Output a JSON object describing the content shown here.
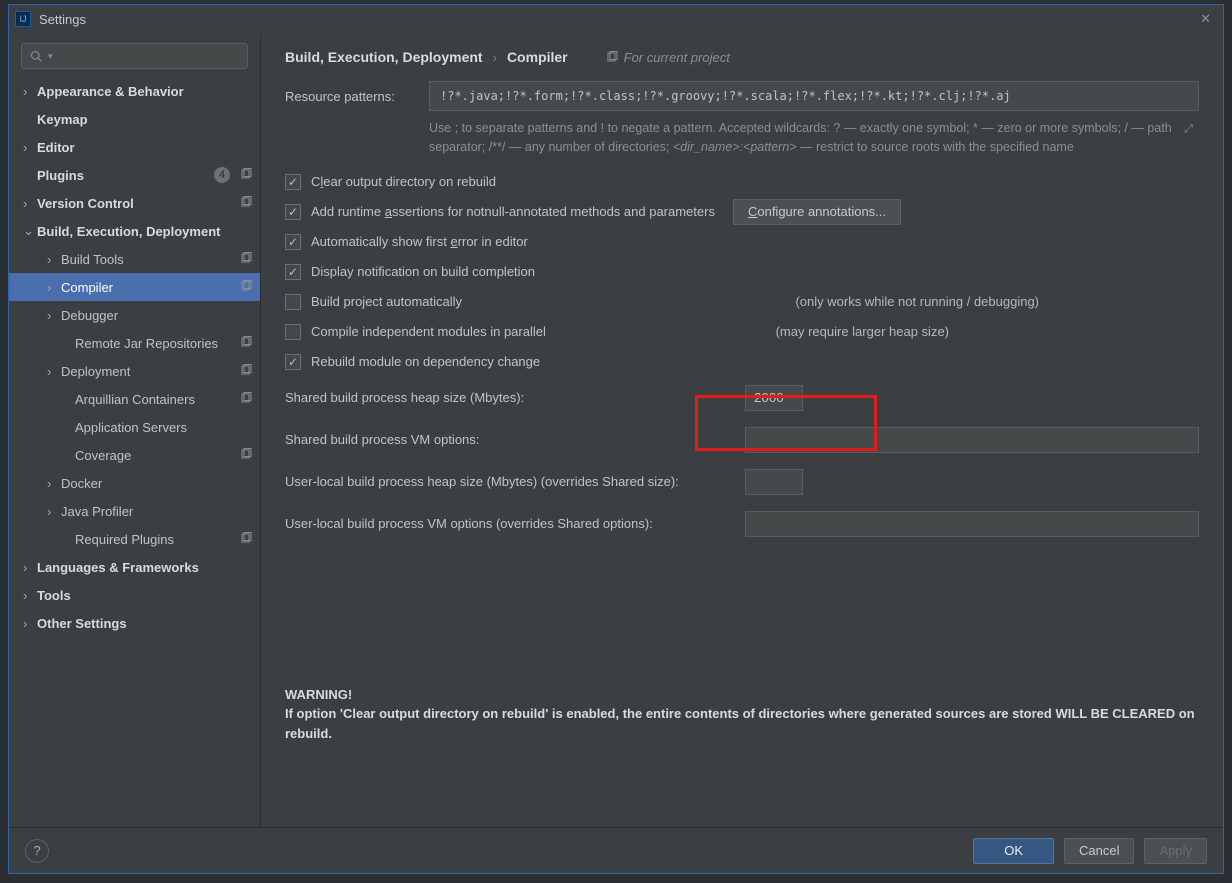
{
  "window": {
    "title": "Settings"
  },
  "search": {
    "placeholder": ""
  },
  "sidebar": {
    "items": [
      {
        "label": "Appearance & Behavior",
        "level": 1,
        "expand": "right",
        "bold": true,
        "copy": false
      },
      {
        "label": "Keymap",
        "level": 1,
        "expand": "none",
        "bold": true,
        "copy": false
      },
      {
        "label": "Editor",
        "level": 1,
        "expand": "right",
        "bold": true,
        "copy": false
      },
      {
        "label": "Plugins",
        "level": 1,
        "expand": "none",
        "bold": true,
        "copy": true,
        "badge": "4"
      },
      {
        "label": "Version Control",
        "level": 1,
        "expand": "right",
        "bold": true,
        "copy": true
      },
      {
        "label": "Build, Execution, Deployment",
        "level": 1,
        "expand": "down",
        "bold": true,
        "copy": false
      },
      {
        "label": "Build Tools",
        "level": 2,
        "expand": "right",
        "bold": false,
        "copy": true
      },
      {
        "label": "Compiler",
        "level": 2,
        "expand": "right",
        "bold": false,
        "copy": true,
        "selected": true
      },
      {
        "label": "Debugger",
        "level": 2,
        "expand": "right",
        "bold": false,
        "copy": false
      },
      {
        "label": "Remote Jar Repositories",
        "level": 3,
        "expand": "none",
        "bold": false,
        "copy": true
      },
      {
        "label": "Deployment",
        "level": 2,
        "expand": "right",
        "bold": false,
        "copy": true
      },
      {
        "label": "Arquillian Containers",
        "level": 3,
        "expand": "none",
        "bold": false,
        "copy": true
      },
      {
        "label": "Application Servers",
        "level": 3,
        "expand": "none",
        "bold": false,
        "copy": false
      },
      {
        "label": "Coverage",
        "level": 3,
        "expand": "none",
        "bold": false,
        "copy": true
      },
      {
        "label": "Docker",
        "level": 2,
        "expand": "right",
        "bold": false,
        "copy": false
      },
      {
        "label": "Java Profiler",
        "level": 2,
        "expand": "right",
        "bold": false,
        "copy": false
      },
      {
        "label": "Required Plugins",
        "level": 3,
        "expand": "none",
        "bold": false,
        "copy": true
      },
      {
        "label": "Languages & Frameworks",
        "level": 1,
        "expand": "right",
        "bold": true,
        "copy": false
      },
      {
        "label": "Tools",
        "level": 1,
        "expand": "right",
        "bold": true,
        "copy": false
      },
      {
        "label": "Other Settings",
        "level": 1,
        "expand": "right",
        "bold": true,
        "copy": false
      }
    ]
  },
  "breadcrumb": {
    "parent": "Build, Execution, Deployment",
    "child": "Compiler",
    "context": "For current project"
  },
  "resource": {
    "label": "Resource patterns:",
    "value": "!?*.java;!?*.form;!?*.class;!?*.groovy;!?*.scala;!?*.flex;!?*.kt;!?*.clj;!?*.aj",
    "help1": "Use ; to separate patterns and ! to negate a pattern. Accepted wildcards: ? — exactly one symbol; * — zero or more symbols; / — path separator; /**/ — any number of directories; ",
    "help2": "<dir_name>:<pattern>",
    "help3": " — restrict to source roots with the specified name"
  },
  "checks": {
    "clear": {
      "label_pre": "Clear output directory on rebuild",
      "label_u": "",
      "checked": true
    },
    "assertions": {
      "label": "Add runtime assertions for notnull-annotated methods and parameters",
      "checked": true
    },
    "configure": "Configure annotations...",
    "autoerr": {
      "label": "Automatically show first error in editor",
      "checked": true
    },
    "notify": {
      "label": "Display notification on build completion",
      "checked": true
    },
    "autobuild": {
      "label": "Build project automatically",
      "checked": false,
      "note": "(only works while not running / debugging)"
    },
    "parallel": {
      "label": "Compile independent modules in parallel",
      "checked": false,
      "note": "(may require larger heap size)"
    },
    "rebuild_dep": {
      "label": "Rebuild module on dependency change",
      "checked": true
    }
  },
  "fields": {
    "heap": {
      "label": "Shared build process heap size (Mbytes):",
      "value": "2000"
    },
    "vm": {
      "label": "Shared build process VM options:",
      "value": ""
    },
    "uheap": {
      "label": "User-local build process heap size (Mbytes) (overrides Shared size):",
      "value": ""
    },
    "uvm": {
      "label": "User-local build process VM options (overrides Shared options):",
      "value": ""
    }
  },
  "warning": {
    "title": "WARNING!",
    "body": "If option 'Clear output directory on rebuild' is enabled, the entire contents of directories where generated sources are stored WILL BE CLEARED on rebuild."
  },
  "footer": {
    "ok": "OK",
    "cancel": "Cancel",
    "apply": "Apply"
  }
}
